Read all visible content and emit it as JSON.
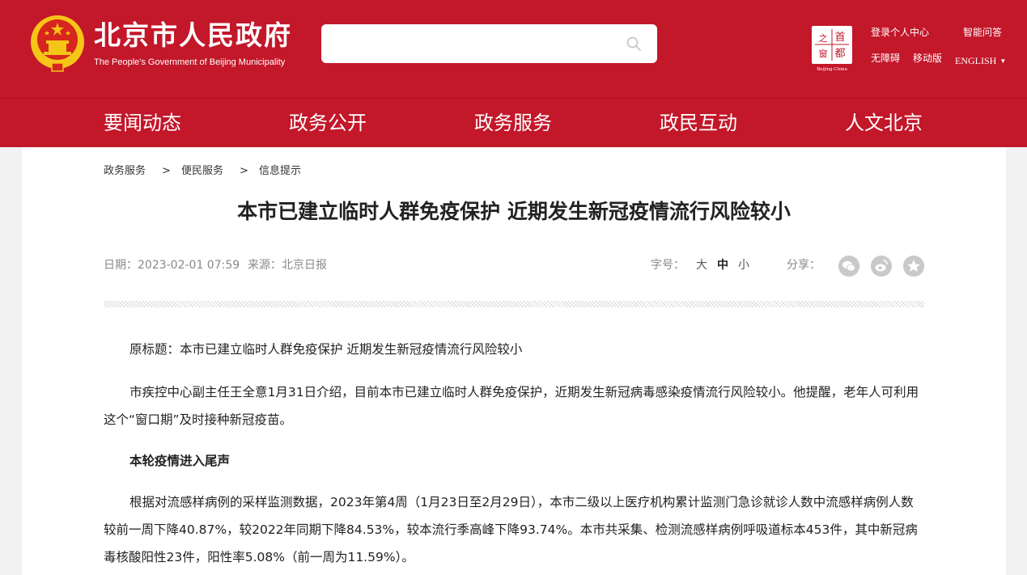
{
  "header": {
    "title_cn": "北京市人民政府",
    "title_en": "The People's Government of Beijing Municipality",
    "search": {
      "placeholder": ""
    },
    "links": {
      "login": "登录个人中心",
      "ai_qa": "智能问答",
      "accessibility": "无障碍",
      "mobile": "移动版",
      "english": "ENGLISH"
    },
    "seal_text": [
      "首",
      "之",
      "都",
      "窗"
    ],
    "seal_caption": "Beijing-China"
  },
  "nav": [
    "要闻动态",
    "政务公开",
    "政务服务",
    "政民互动",
    "人文北京"
  ],
  "breadcrumb": {
    "items": [
      "政务服务",
      "便民服务",
      "信息提示"
    ],
    "separator": ">"
  },
  "article": {
    "title": "本市已建立临时人群免疫保护 近期发生新冠疫情流行风险较小",
    "date": "日期：2023-02-01 07:59",
    "source": "来源：北京日报",
    "font_label": "字号：",
    "font_sizes": [
      "大",
      "中",
      "小"
    ],
    "share_label": "分享：",
    "paragraphs": [
      "原标题：本市已建立临时人群免疫保护 近期发生新冠疫情流行风险较小",
      "市疾控中心副主任王全意1月31日介绍，目前本市已建立临时人群免疫保护，近期发生新冠病毒感染疫情流行风险较小。他提醒，老年人可利用这个“窗口期”及时接种新冠疫苗。",
      "本轮疫情进入尾声",
      "根据对流感样病例的采样监测数据，2023年第4周（1月23日至2月29日），本市二级以上医疗机构累计监测门急诊就诊人数中流感样病例人数较前一周下降40.87%，较2022年同期下降84.53%，较本流行季高峰下降93.74%。本市共采集、检测流感样病例呼吸道标本453件，其中新冠病毒核酸阳性23件，阳性率5.08%（前一周为11.59%）。"
    ]
  },
  "colors": {
    "brand_red": "#c3172a",
    "gold": "#f5c518"
  }
}
